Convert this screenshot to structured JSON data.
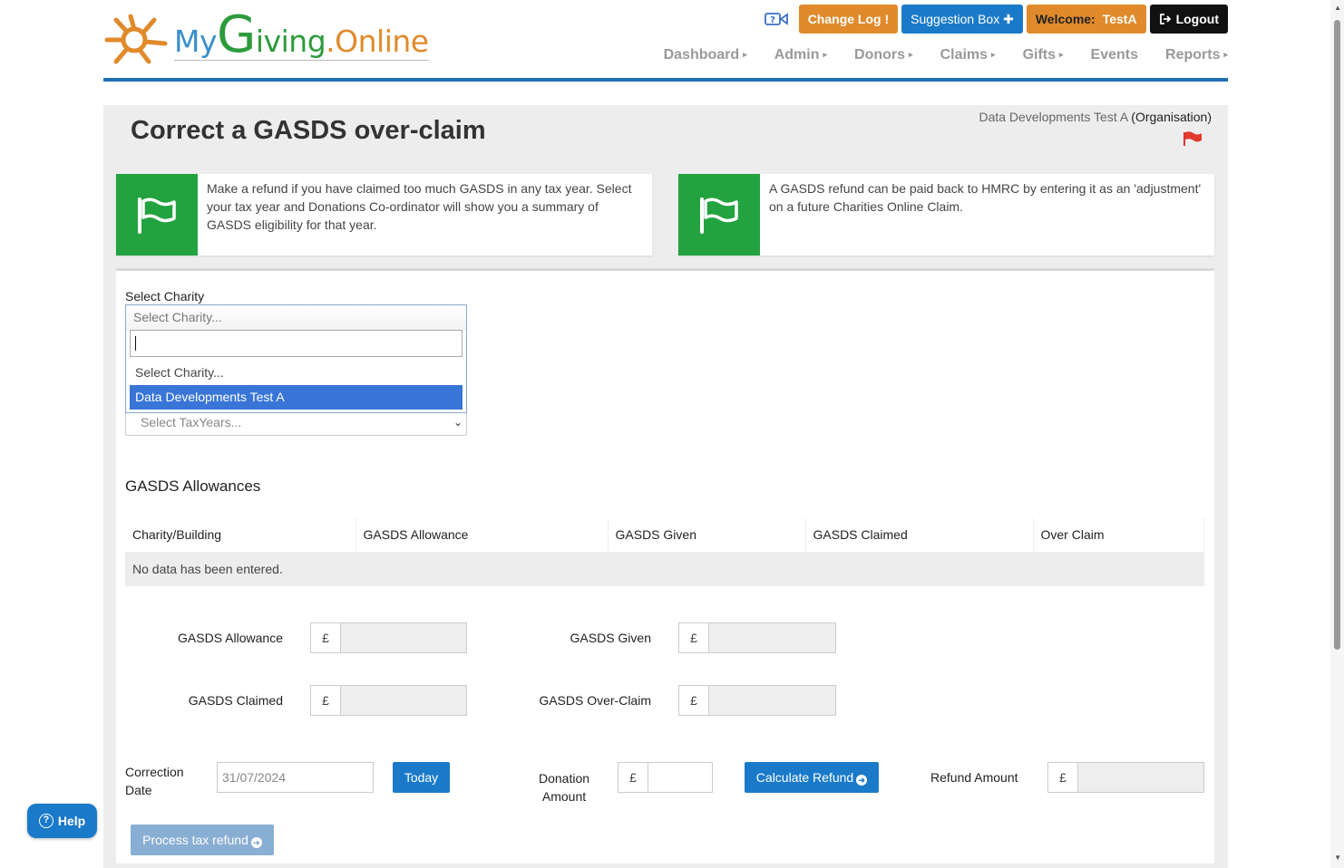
{
  "logo": {
    "my": "My",
    "g": "G",
    "iving": "iving",
    "dot": ".",
    "online": "Online"
  },
  "top": {
    "change_log": "Change Log",
    "change_log_mark": "!",
    "suggestion_box": "Suggestion Box",
    "suggestion_mark": "✚",
    "welcome_label": "Welcome:",
    "welcome_user": "TestA",
    "logout": "Logout"
  },
  "nav": [
    {
      "label": "Dashboard",
      "caret": "▸"
    },
    {
      "label": "Admin",
      "caret": "▸"
    },
    {
      "label": "Donors",
      "caret": "▸"
    },
    {
      "label": "Claims",
      "caret": "▸"
    },
    {
      "label": "Gifts",
      "caret": "▸"
    },
    {
      "label": "Events",
      "caret": ""
    },
    {
      "label": "Reports",
      "caret": "▸"
    }
  ],
  "page": {
    "title": "Correct a GASDS over-claim",
    "org_name": "Data Developments Test A",
    "org_type": "(Organisation)"
  },
  "info": {
    "left": "Make a refund if you have claimed too much GASDS in any tax year. Select your tax year and Donations Co-ordinator will show you a summary of GASDS eligibility for that year.",
    "right": "A GASDS refund can be paid back to HMRC by entering it as an 'adjustment' on a future Charities Online Claim."
  },
  "form": {
    "charity_label": "Select Charity",
    "charity_placeholder": "Select Charity...",
    "search_value": "",
    "options": [
      "Select Charity...",
      "Data Developments Test A"
    ],
    "taxyear_placeholder": "Select TaxYears...",
    "allowances_heading": "GASDS Allowances",
    "columns": [
      "Charity/Building",
      "GASDS Allowance",
      "GASDS Given",
      "GASDS Claimed",
      "Over Claim"
    ],
    "no_data": "No data has been entered.",
    "currency": "£",
    "gasds_allowance": "GASDS Allowance",
    "gasds_given": "GASDS Given",
    "gasds_claimed": "GASDS Claimed",
    "gasds_overclaim": "GASDS Over-Claim",
    "correction_date_l1": "Correction",
    "correction_date_l2": "Date",
    "correction_date_value": "31/07/2024",
    "today": "Today",
    "donation_amount_l1": "Donation",
    "donation_amount_l2": "Amount",
    "calculate_refund": "Calculate Refund",
    "refund_amount": "Refund Amount",
    "process_refund": "Process tax refund"
  },
  "help": "Help",
  "colors": {
    "accent_blue": "#1a7ac9",
    "orange": "#e08a2b",
    "green": "#23a340",
    "rule": "#1f6fb5"
  }
}
